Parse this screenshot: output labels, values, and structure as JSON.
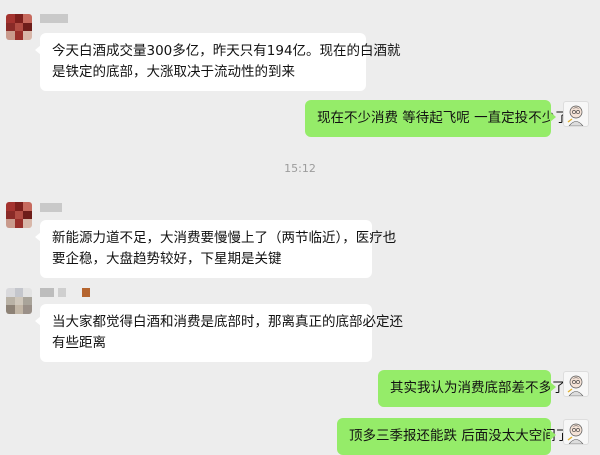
{
  "timestamp": "15:12",
  "messages": [
    {
      "side": "in",
      "lines": [
        "今天白酒成交量300多亿，昨天只有194亿。现在的白酒就",
        "是铁定的底部，大涨取决于流动性的到来"
      ]
    },
    {
      "side": "out",
      "lines": [
        "现在不少消费 等待起飞呢  一直定投不少了"
      ]
    },
    {
      "side": "in",
      "lines": [
        "新能源力道不足，大消费要慢慢上了（两节临近），医疗也",
        "要企稳，大盘趋势较好，下星期是关键"
      ]
    },
    {
      "side": "in",
      "lines": [
        "当大家都觉得白酒和消费是底部时，那离真正的底部必定还",
        "有些距离"
      ]
    },
    {
      "side": "out",
      "lines": [
        "其实我认为消费底部差不多了"
      ]
    },
    {
      "side": "out",
      "lines": [
        "顶多三季报还能跌 后面没太大空间了"
      ]
    }
  ],
  "colors": {
    "background": "#ededed",
    "incoming_bubble": "#ffffff",
    "outgoing_bubble": "#95ec69"
  }
}
